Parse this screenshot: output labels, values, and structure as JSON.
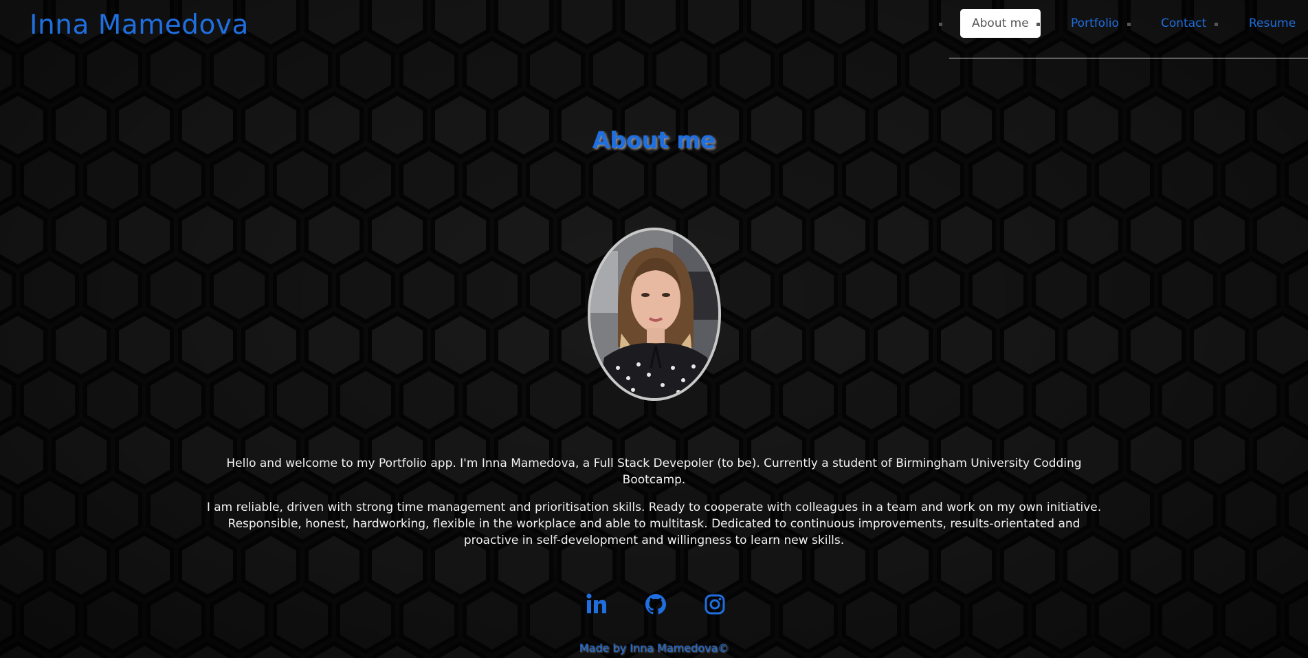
{
  "header": {
    "brand_name": "Inna Mamedova"
  },
  "nav": {
    "items": [
      {
        "label": "About me",
        "active": true
      },
      {
        "label": "Portfolio",
        "active": false
      },
      {
        "label": "Contact",
        "active": false
      },
      {
        "label": "Resume",
        "active": false
      }
    ]
  },
  "about": {
    "title": "About me",
    "photo_alt": "Inna Mamedova",
    "paragraph_1": "Hello and welcome to my Portfolio app. I'm Inna Mamedova, a Full Stack Devepoler (to be). Currently a student of Birmingham University Codding Bootcamp.",
    "paragraph_2": "I am reliable, driven with strong time management and prioritisation skills. Ready to cooperate with colleagues in a team and work on my own initiative. Responsible, honest, hardworking, flexible in the workplace and able to multitask. Dedicated to continuous improvements, results-orientated and proactive in self-development and willingness to learn new skills."
  },
  "social": {
    "icons": [
      "linkedin-icon",
      "github-icon",
      "instagram-icon"
    ]
  },
  "footer": {
    "text": "Made by Inna Mamedova©"
  },
  "colors": {
    "accent": "#1f6fe0",
    "background": "#0b0b0b",
    "text": "#f2f2f2",
    "active_tab_bg": "#ffffff",
    "active_tab_text": "#555555"
  }
}
